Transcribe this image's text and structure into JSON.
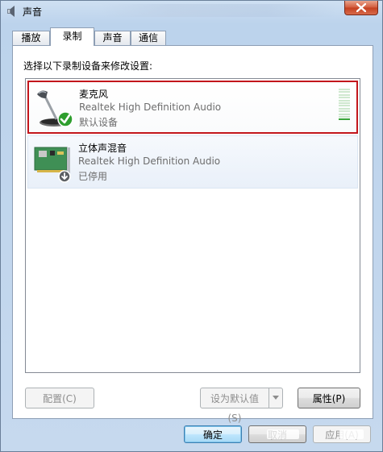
{
  "window": {
    "title": "声音"
  },
  "tabs": [
    {
      "label": "播放",
      "active": false
    },
    {
      "label": "录制",
      "active": true
    },
    {
      "label": "声音",
      "active": false
    },
    {
      "label": "通信",
      "active": false
    }
  ],
  "panel": {
    "instruction": "选择以下录制设备来修改设置:",
    "devices": [
      {
        "name": "麦克风",
        "driver": "Realtek High Definition Audio",
        "status": "默认设备",
        "icon": "microphone-icon",
        "badge": "default-check-icon",
        "selected": true,
        "level_fraction": 0.1
      },
      {
        "name": "立体声混音",
        "driver": "Realtek High Definition Audio",
        "status": "已停用",
        "icon": "sound-card-icon",
        "badge": "disabled-arrow-icon",
        "selected": false
      }
    ],
    "buttons": {
      "configure": "配置(C)",
      "set_default": "设为默认值(S)",
      "properties": "属性(P)"
    }
  },
  "dialog_buttons": {
    "ok": "确定",
    "cancel": "取消",
    "apply": "应用(A)"
  },
  "colors": {
    "selection_border": "#c3161c",
    "check_green": "#2e9e2e",
    "meter_green": "#3aa43a"
  }
}
